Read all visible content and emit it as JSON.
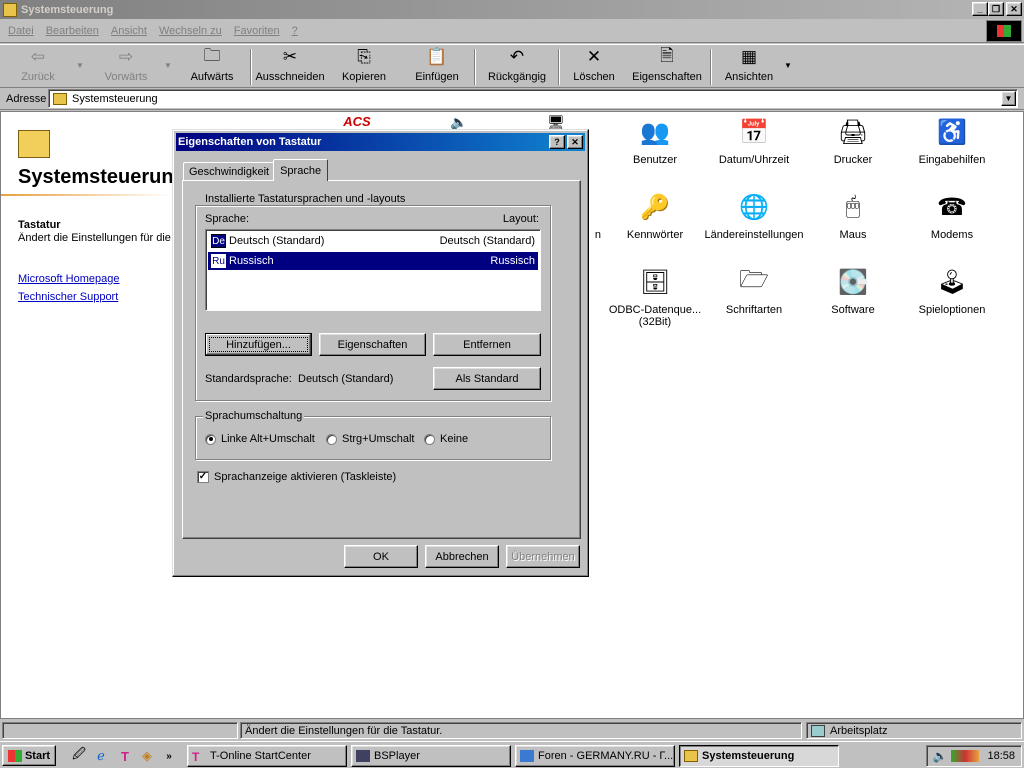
{
  "window": {
    "title": "Systemsteuerung"
  },
  "menu": [
    "Datei",
    "Bearbeiten",
    "Ansicht",
    "Wechseln zu",
    "Favoriten",
    "?"
  ],
  "toolbar": {
    "back": "Zurück",
    "forward": "Vorwärts",
    "up": "Aufwärts",
    "cut": "Ausschneiden",
    "copy": "Kopieren",
    "paste": "Einfügen",
    "undo": "Rückgängig",
    "delete": "Löschen",
    "properties": "Eigenschaften",
    "views": "Ansichten"
  },
  "address": {
    "label": "Adresse",
    "value": "Systemsteuerung"
  },
  "leftpane": {
    "title": "Systemsteuerung",
    "selected_name": "Tastatur",
    "selected_desc": "Ändert die Einstellungen für die Tastatur.",
    "links": [
      "Microsoft Homepage",
      "Technischer Support"
    ]
  },
  "items": {
    "benutzer": "Benutzer",
    "datum": "Datum/Uhrzeit",
    "drucker": "Drucker",
    "eingabehilfen": "Eingabehilfen",
    "partial_n": "n",
    "kennwoerter": "Kennwörter",
    "laender": "Ländereinstellungen",
    "maus": "Maus",
    "modems": "Modems",
    "odbc": "ODBC-Datenque... (32Bit)",
    "schriftarten": "Schriftarten",
    "software": "Software",
    "spieloptionen": "Spieloptionen",
    "acs_label": "ACS"
  },
  "dialog": {
    "title": "Eigenschaften von Tastatur",
    "tabs": [
      "Geschwindigkeit",
      "Sprache"
    ],
    "group_installed": "Installierte Tastatursprachen und -layouts",
    "col_language": "Sprache:",
    "col_layout": "Layout:",
    "languages": [
      {
        "code": "De",
        "name": "Deutsch (Standard)",
        "layout": "Deutsch (Standard)"
      },
      {
        "code": "Ru",
        "name": "Russisch",
        "layout": "Russisch"
      }
    ],
    "btn_add": "Hinzufügen...",
    "btn_props": "Eigenschaften",
    "btn_remove": "Entfernen",
    "default_label": "Standardsprache:",
    "default_value": "Deutsch (Standard)",
    "btn_set_default": "Als Standard",
    "group_switch": "Sprachumschaltung",
    "radio_alt": "Linke Alt+Umschalt",
    "radio_ctrl": "Strg+Umschalt",
    "radio_none": "Keine",
    "checkbox_indicator": "Sprachanzeige aktivieren (Taskleiste)",
    "btn_ok": "OK",
    "btn_cancel": "Abbrechen",
    "btn_apply": "Übernehmen"
  },
  "status": {
    "text": "Ändert die Einstellungen für die Tastatur.",
    "zone": "Arbeitsplatz"
  },
  "taskbar": {
    "start": "Start",
    "tasks": [
      "T-Online StartCenter",
      "BSPlayer",
      "Foren - GERMANY.RU - Г...",
      "Systemsteuerung"
    ],
    "clock": "18:58"
  }
}
